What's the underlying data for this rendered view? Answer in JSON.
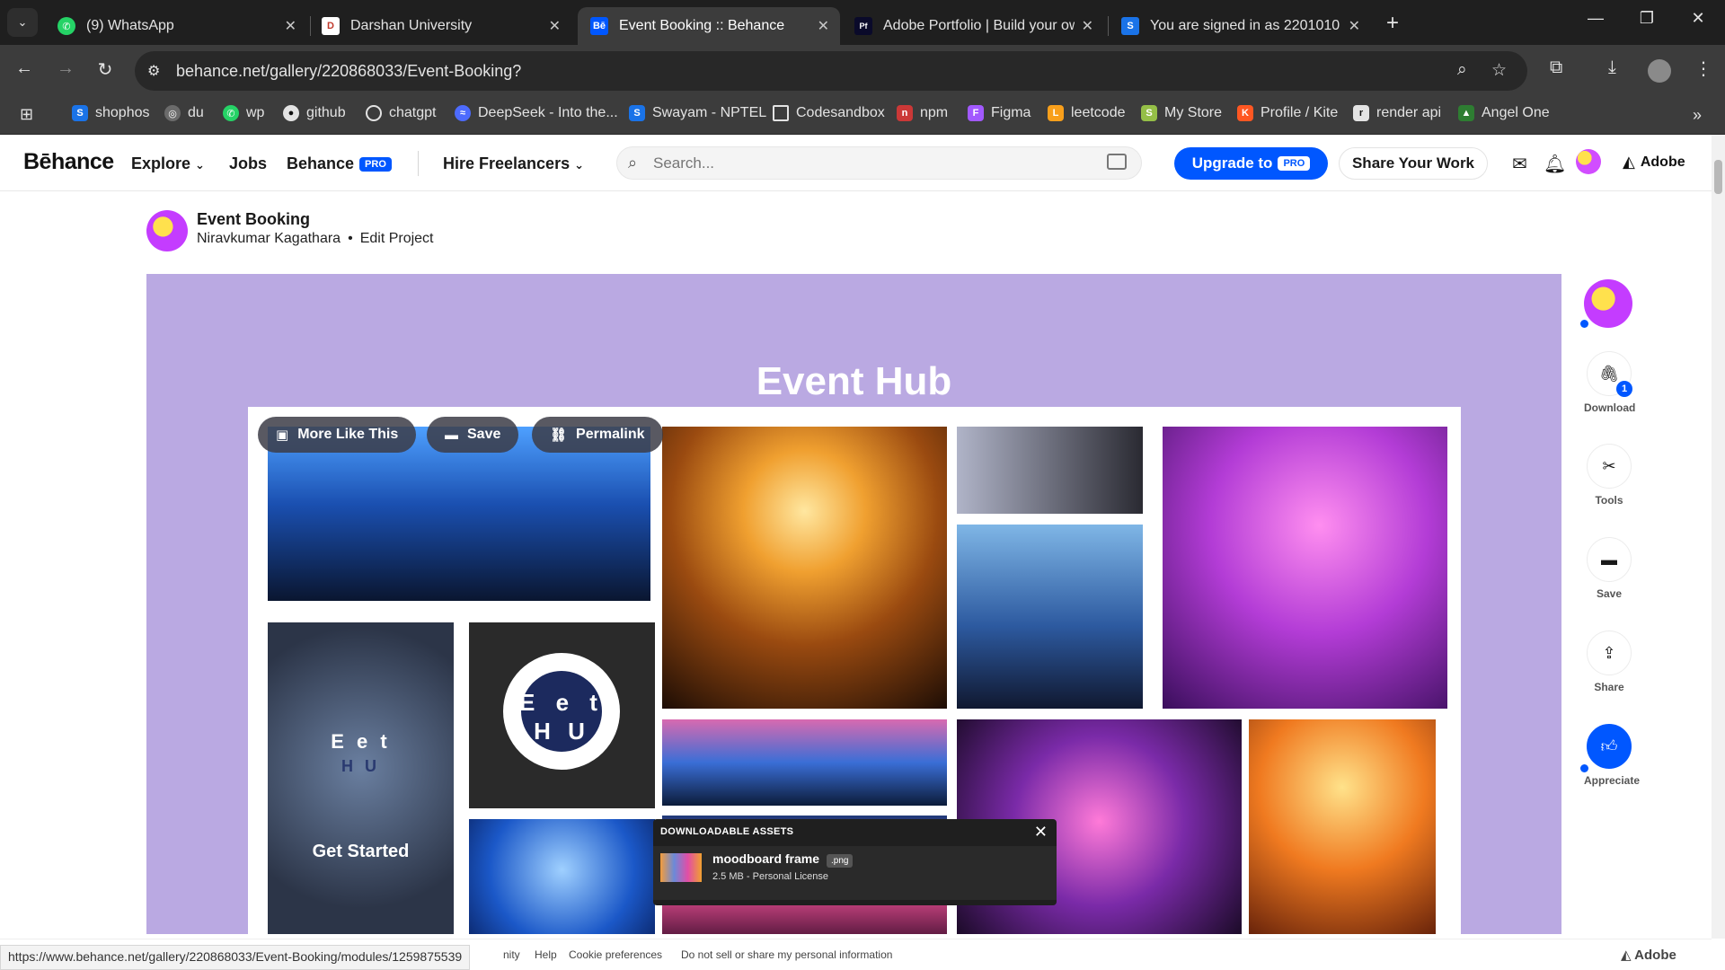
{
  "browser": {
    "tabs": [
      {
        "title": "(9) WhatsApp",
        "icon": "whatsapp-icon",
        "color": "#25d366"
      },
      {
        "title": "Darshan University",
        "icon": "darshan-icon",
        "color": "#c0392b"
      },
      {
        "title": "Event Booking :: Behance",
        "icon": "behance-icon",
        "color": "#0057ff"
      },
      {
        "title": "Adobe Portfolio | Build your ow",
        "icon": "adobe-portfolio-icon",
        "color": "#0a0a2a"
      },
      {
        "title": "You are signed in as 2201010",
        "icon": "swayam-icon",
        "color": "#1a73e8"
      }
    ],
    "url": "behance.net/gallery/220868033/Event-Booking?",
    "bookmarks": [
      {
        "label": "shophos",
        "color": "#1a73e8"
      },
      {
        "label": "du",
        "color": "#6b6b6b"
      },
      {
        "label": "wp",
        "color": "#25d366"
      },
      {
        "label": "github",
        "color": "#e3e3e3"
      },
      {
        "label": "chatgpt",
        "color": "#e3e3e3"
      },
      {
        "label": "DeepSeek - Into the...",
        "color": "#4d6bfe"
      },
      {
        "label": "Swayam - NPTEL",
        "color": "#1a73e8"
      },
      {
        "label": "Codesandbox",
        "color": "#e3e3e3"
      },
      {
        "label": "npm",
        "color": "#cb3837"
      },
      {
        "label": "Figma",
        "color": "#a259ff"
      },
      {
        "label": "leetcode",
        "color": "#f89f1b"
      },
      {
        "label": "My Store",
        "color": "#95bf47"
      },
      {
        "label": "Profile / Kite",
        "color": "#ff5722"
      },
      {
        "label": "render api",
        "color": "#e3e3e3"
      },
      {
        "label": "Angel One",
        "color": "#2e7d32"
      }
    ]
  },
  "behance": {
    "logo": "Bēhance",
    "nav": {
      "explore": "Explore",
      "jobs": "Jobs",
      "behance": "Behance",
      "pro": "PRO",
      "hire": "Hire Freelancers"
    },
    "search_placeholder": "Search...",
    "upgrade_label": "Upgrade to",
    "share_work": "Share Your Work",
    "adobe": "Adobe"
  },
  "project": {
    "title": "Event Booking",
    "owner": "Niravkumar Kagathara",
    "separator": "•",
    "edit": "Edit Project",
    "canvas_title": "Event Hub",
    "tile_text_1": "E e t",
    "tile_text_2": "H U",
    "tile_text_3": "E e t",
    "tile_text_4": "H U",
    "get_started": "Get Started",
    "float_buttons": {
      "more_like": "More Like This",
      "save": "Save",
      "permalink": "Permalink"
    }
  },
  "assets": {
    "header": "DOWNLOADABLE ASSETS",
    "name": "moodboard frame",
    "ext": ".png",
    "meta": "2.5 MB - Personal License"
  },
  "sidebar": {
    "download": "Download",
    "download_count": "1",
    "tools": "Tools",
    "save": "Save",
    "share": "Share",
    "appreciate": "Appreciate"
  },
  "footer": {
    "community": "nity",
    "help": "Help",
    "cookies": "Cookie preferences",
    "donotsell": "Do not sell or share my personal information",
    "adobe": "Adobe"
  },
  "status_url": "https://www.behance.net/gallery/220868033/Event-Booking/modules/1259875539",
  "colors": {
    "accent": "#0057ff",
    "canvas": "#baa9e2"
  }
}
